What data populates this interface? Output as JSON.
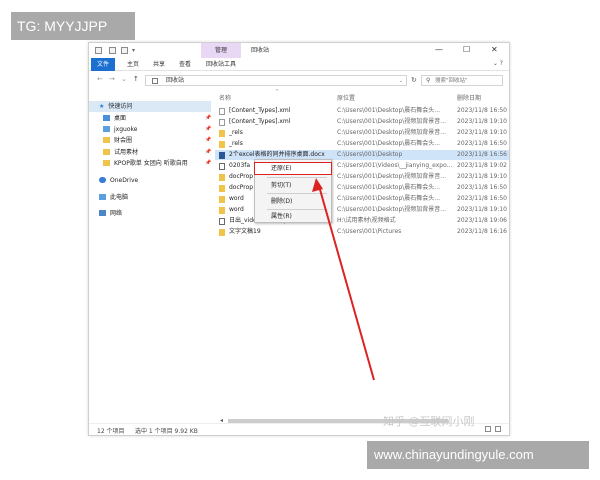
{
  "watermarks": {
    "top_left": "TG: MYYJJPP",
    "bottom_right": "www.chinayundingyule.com",
    "zhihu": "知乎 @互联网小刚"
  },
  "window": {
    "manage_tab": "管理",
    "title": "回收站",
    "minimize": "—",
    "maximize": "☐",
    "close": "✕"
  },
  "ribbon": {
    "tabs": [
      "文件",
      "主页",
      "共享",
      "查看",
      "回收站工具"
    ],
    "expand": "⌄ ?"
  },
  "address": {
    "path": "回收站",
    "search_placeholder": "搜索\"回收站\""
  },
  "sidebar": {
    "items": [
      {
        "label": "快速访问",
        "icon": "star-icon"
      },
      {
        "label": "桌面",
        "icon": "desktop-icon"
      },
      {
        "label": "jxguoke",
        "icon": "pc-icon"
      },
      {
        "label": "财会圈",
        "icon": "folder-icon"
      },
      {
        "label": "试用素材",
        "icon": "folder-icon"
      },
      {
        "label": "KPOP歌单 女团向 听歌自用",
        "icon": "folder-icon"
      },
      {
        "label": "OneDrive",
        "icon": "cloud-icon"
      },
      {
        "label": "此电脑",
        "icon": "computer-icon"
      },
      {
        "label": "网络",
        "icon": "network-icon"
      }
    ]
  },
  "columns": {
    "name": "名称",
    "location": "原位置",
    "date": "删除日期"
  },
  "files": [
    {
      "name": "[Content_Types].xml",
      "location": "C:\\Users\\001\\Desktop\\晨石舞会头...",
      "date": "2023/11/8 16:50",
      "icon": "doc"
    },
    {
      "name": "[Content_Types].xml",
      "location": "C:\\Users\\001\\Desktop\\视频加背景音...",
      "date": "2023/11/8 19:10",
      "icon": "doc"
    },
    {
      "name": "_rels",
      "location": "C:\\Users\\001\\Desktop\\视频加背景音...",
      "date": "2023/11/8 19:10",
      "icon": "folder"
    },
    {
      "name": "_rels",
      "location": "C:\\Users\\001\\Desktop\\晨石舞会头...",
      "date": "2023/11/8 16:50",
      "icon": "folder"
    },
    {
      "name": "2个excel表格的同并排序桌面.docx",
      "location": "C:\\Users\\001\\Desktop",
      "date": "2023/11/8 16:56",
      "icon": "word"
    },
    {
      "name": "0203fa",
      "location": "C:\\Users\\001\\Videos\\__jianying_expo...",
      "date": "2023/11/8 19:02",
      "icon": "video"
    },
    {
      "name": "docProp",
      "location": "C:\\Users\\001\\Desktop\\视频加背景音...",
      "date": "2023/11/8 19:10",
      "icon": "folder"
    },
    {
      "name": "docProp",
      "location": "C:\\Users\\001\\Desktop\\晨石舞会头...",
      "date": "2023/11/8 16:50",
      "icon": "folder"
    },
    {
      "name": "word",
      "location": "C:\\Users\\001\\Desktop\\晨石舞会头...",
      "date": "2023/11/8 16:50",
      "icon": "folder"
    },
    {
      "name": "word",
      "location": "C:\\Users\\001\\Desktop\\视频加背景音...",
      "date": "2023/11/8 19:10",
      "icon": "folder"
    },
    {
      "name": "日出_video.Daubmp4",
      "location": "H:\\试用素材\\视频格式",
      "date": "2023/11/8 19:06",
      "icon": "video"
    },
    {
      "name": "文字文稿19",
      "location": "C:\\Users\\001\\Pictures",
      "date": "2023/11/8 16:16",
      "icon": "folder"
    }
  ],
  "context_menu": {
    "items": [
      "还原(E)",
      "剪切(T)",
      "删除(D)",
      "属性(R)"
    ]
  },
  "status": {
    "count": "12 个项目",
    "selected": "选中 1 个项目  9.92 KB"
  },
  "colors": {
    "file_tab": "#1a6fd1",
    "manage_tab": "#e8d7f5",
    "highlight": "#dd2222",
    "selection": "#cfe3f9"
  }
}
